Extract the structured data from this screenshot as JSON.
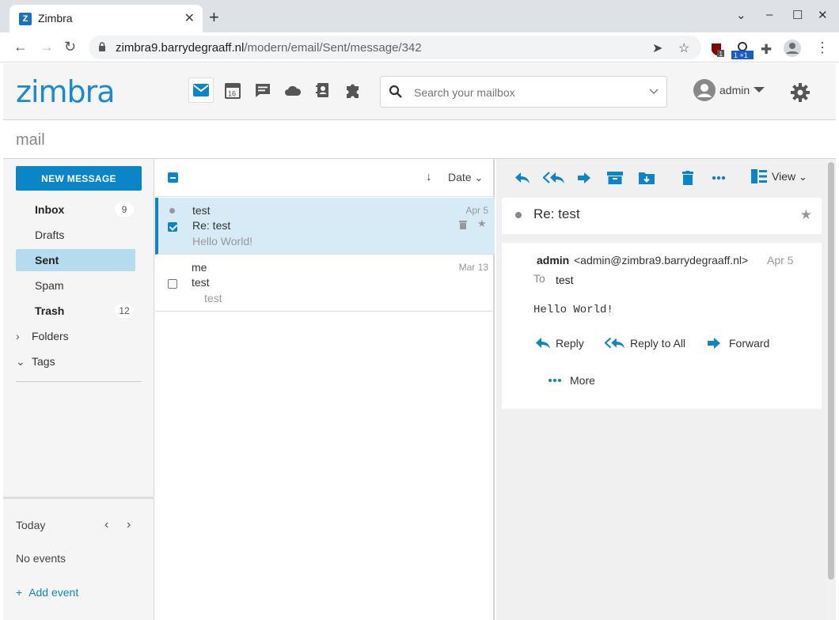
{
  "browser": {
    "tab_title": "Zimbra",
    "tab_favicon": "Z",
    "url_host": "zimbra9.barrydegraaff.nl",
    "url_path": "/modern/email/Sent/message/342",
    "ext_badge_1": "1",
    "ext_badge_2": "1 +1"
  },
  "header": {
    "logo": "zimbra",
    "calendar_day": "16",
    "search_placeholder": "Search your mailbox",
    "user_name": "admin"
  },
  "app_title": "mail",
  "sidebar": {
    "new_message_label": "NEW MESSAGE",
    "folders": [
      {
        "label": "Inbox",
        "count": "9"
      },
      {
        "label": "Drafts",
        "count": ""
      },
      {
        "label": "Sent",
        "count": ""
      },
      {
        "label": "Spam",
        "count": ""
      },
      {
        "label": "Trash",
        "count": "12"
      }
    ],
    "folders_tree_label": "Folders",
    "tags_tree_label": "Tags",
    "calendar": {
      "today_label": "Today",
      "no_events": "No events",
      "add_event": "Add event"
    }
  },
  "list": {
    "sort_label": "Date",
    "messages": [
      {
        "from": "test",
        "subject": "Re: test",
        "preview": "Hello World!",
        "date": "Apr 5"
      },
      {
        "from": "me",
        "subject": "test",
        "preview": "test",
        "date": "Mar 13"
      }
    ]
  },
  "reader": {
    "view_label": "View",
    "subject": "Re: test",
    "sender_name": "admin",
    "sender_email": "<admin@zimbra9.barrydegraaff.nl>",
    "date": "Apr 5",
    "to_label": "To",
    "to_value": "test",
    "body": "Hello World!",
    "reply_label": "Reply",
    "reply_all_label": "Reply to All",
    "forward_label": "Forward",
    "more_label": "More"
  },
  "colors": {
    "accent": "#0a85c7",
    "selected_folder": "#b5dbee",
    "selected_row": "#d6ebf5"
  }
}
